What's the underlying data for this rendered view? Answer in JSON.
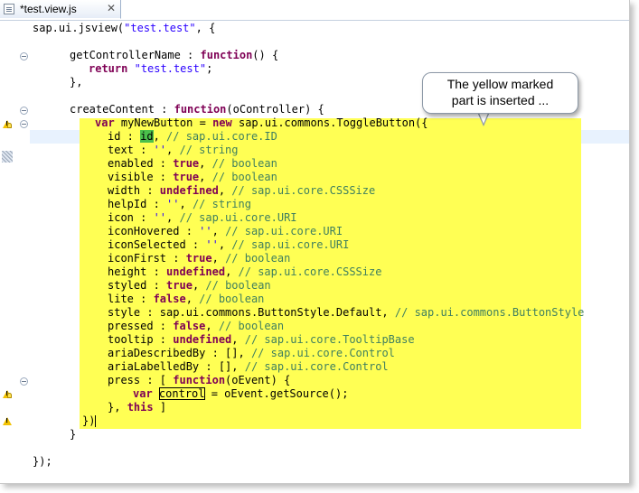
{
  "tab": {
    "title": "*test.view.js",
    "close_glyph": "✕"
  },
  "callout": {
    "line1": "The yellow marked",
    "line2": "part is inserted ..."
  },
  "code": {
    "l1": {
      "a": "sap.ui.jsview(",
      "b": "\"test.test\"",
      "c": ", {"
    },
    "l3": {
      "a": "getControllerName : ",
      "kw": "function",
      "b": "() {"
    },
    "l4": {
      "kw": "return",
      "sp": " ",
      "str": "\"test.test\"",
      "b": ";"
    },
    "l5": {
      "a": "},"
    },
    "l7": {
      "a": "createContent : ",
      "kw": "function",
      "b": "(oController) {"
    },
    "l8": {
      "kw1": "var",
      "a": " myNewButton = ",
      "kw2": "new",
      "b": " sap.ui.commons.ToggleButton({"
    },
    "l9": {
      "a": "id : ",
      "occ": "id",
      "b": ", ",
      "cm": "// sap.ui.core.ID"
    },
    "l10": {
      "a": "text : ",
      "str": "''",
      "b": ", ",
      "cm": "// string"
    },
    "l11": {
      "a": "enabled : ",
      "kw": "true",
      "b": ", ",
      "cm": "// boolean"
    },
    "l12": {
      "a": "visible : ",
      "kw": "true",
      "b": ", ",
      "cm": "// boolean"
    },
    "l13": {
      "a": "width : ",
      "kw": "undefined",
      "b": ", ",
      "cm": "// sap.ui.core.CSSSize"
    },
    "l14": {
      "a": "helpId : ",
      "str": "''",
      "b": ", ",
      "cm": "// string"
    },
    "l15": {
      "a": "icon : ",
      "str": "''",
      "b": ", ",
      "cm": "// sap.ui.core.URI"
    },
    "l16": {
      "a": "iconHovered : ",
      "str": "''",
      "b": ", ",
      "cm": "// sap.ui.core.URI"
    },
    "l17": {
      "a": "iconSelected : ",
      "str": "''",
      "b": ", ",
      "cm": "// sap.ui.core.URI"
    },
    "l18": {
      "a": "iconFirst : ",
      "kw": "true",
      "b": ", ",
      "cm": "// boolean"
    },
    "l19": {
      "a": "height : ",
      "kw": "undefined",
      "b": ", ",
      "cm": "// sap.ui.core.CSSSize"
    },
    "l20": {
      "a": "styled : ",
      "kw": "true",
      "b": ", ",
      "cm": "// boolean"
    },
    "l21": {
      "a": "lite : ",
      "kw": "false",
      "b": ", ",
      "cm": "// boolean"
    },
    "l22": {
      "a": "style : sap.ui.commons.ButtonStyle.Default, ",
      "cm": "// sap.ui.commons.ButtonStyle"
    },
    "l23": {
      "a": "pressed : ",
      "kw": "false",
      "b": ", ",
      "cm": "// boolean"
    },
    "l24": {
      "a": "tooltip : ",
      "kw": "undefined",
      "b": ", ",
      "cm": "// sap.ui.core.TooltipBase"
    },
    "l25": {
      "a": "ariaDescribedBy : [], ",
      "cm": "// sap.ui.core.Control"
    },
    "l26": {
      "a": "ariaLabelledBy : [], ",
      "cm": "// sap.ui.core.Control"
    },
    "l27": {
      "a": "press : [ ",
      "kw": "function",
      "b": "(oEvent) {"
    },
    "l28": {
      "kw": "var",
      "sp": " ",
      "box": "control",
      "b": " = oEvent.getSource();"
    },
    "l29": {
      "a": "}, ",
      "kw": "this",
      "b": " ]"
    },
    "l30": {
      "a": "})"
    },
    "l31": {
      "a": "}"
    },
    "l33": {
      "a": "});"
    }
  },
  "colors": {
    "highlight": "#ffff54",
    "keyword": "#7f0055",
    "string": "#2a00ff",
    "comment": "#3f7f5f",
    "occurrence": "#4bc04b"
  }
}
